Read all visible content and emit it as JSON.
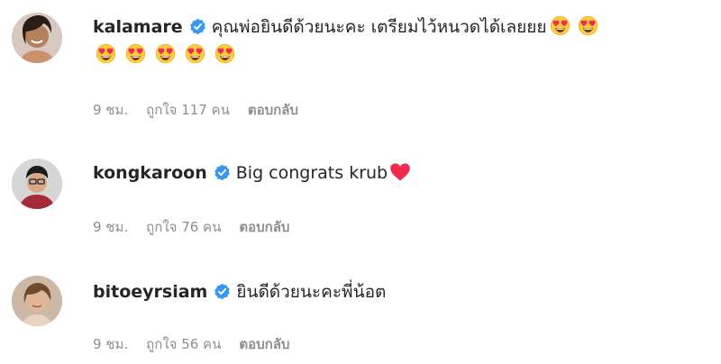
{
  "comments": [
    {
      "username": "kalamare",
      "text": "คุณพ่อยินดีด้วยนะคะ เตรียมไว้หนวดได้เลยยย",
      "emoji_line1": [
        "heart-eyes-emoji",
        "heart-eyes-emoji"
      ],
      "emoji_line2": [
        "heart-eyes-emoji",
        "heart-eyes-emoji",
        "heart-eyes-emoji",
        "heart-eyes-emoji",
        "heart-eyes-emoji"
      ],
      "time": "9 ชม.",
      "likes": "ถูกใจ 117 คน",
      "reply": "ตอบกลับ"
    },
    {
      "username": "kongkaroon",
      "text": "Big congrats krub",
      "emoji": "red-heart-emoji",
      "time": "9 ชม.",
      "likes": "ถูกใจ 76 คน",
      "reply": "ตอบกลับ"
    },
    {
      "username": "bitoeyrsiam",
      "text": "ยินดีด้วยนะคะพี่น้อต",
      "time": "9 ชม.",
      "likes": "ถูกใจ 56 คน",
      "reply": "ตอบกลับ"
    }
  ],
  "colors": {
    "verified_badge": "#3897f0",
    "meta_text": "#8e8e8e",
    "heart": "#ed4956",
    "emoji_face": "#ffcc3e"
  }
}
